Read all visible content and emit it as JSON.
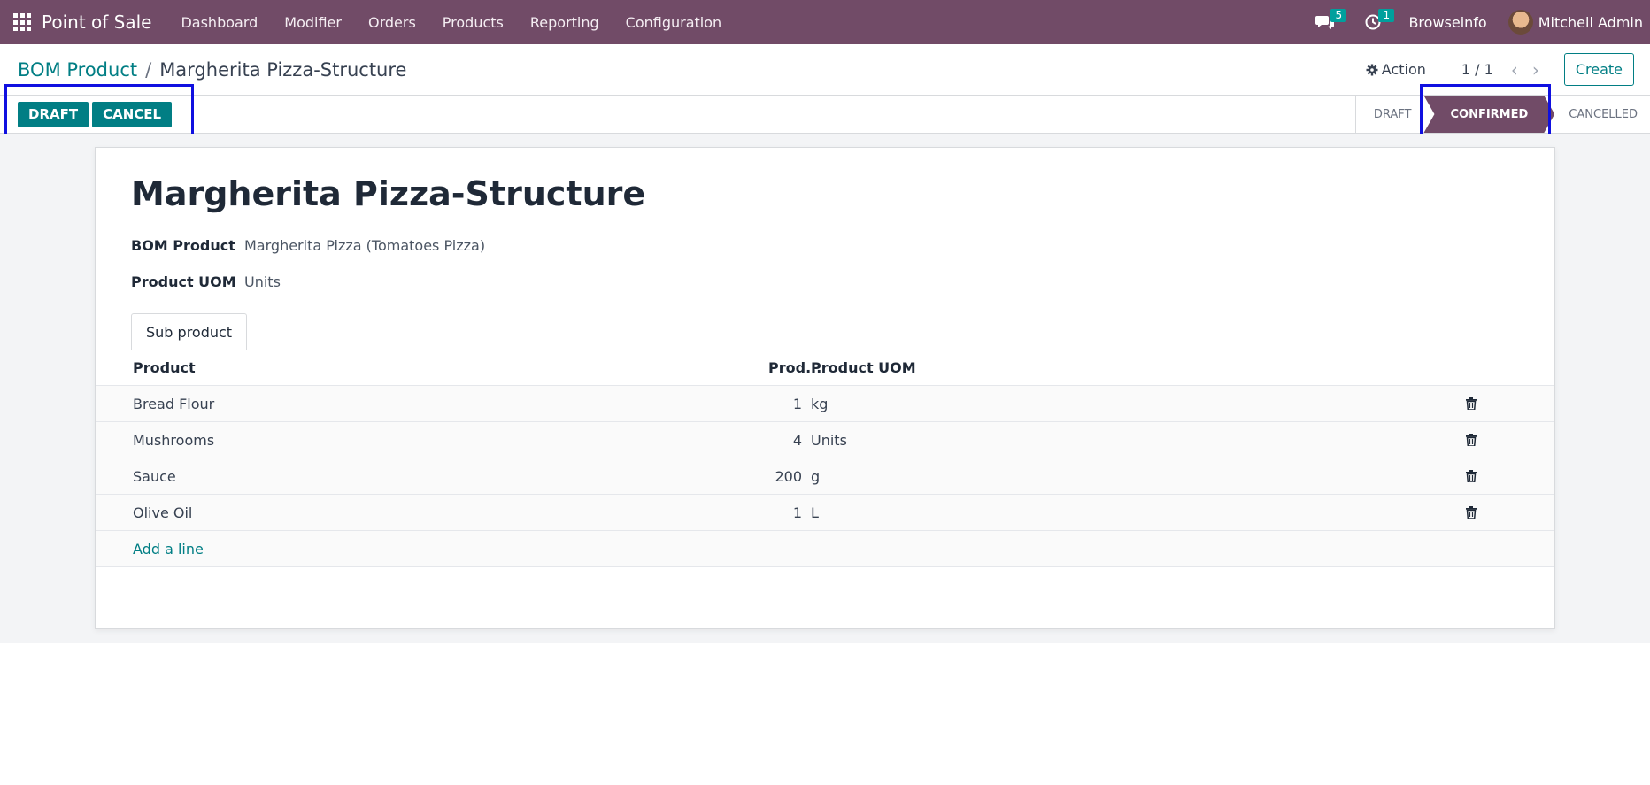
{
  "navbar": {
    "brand": "Point of Sale",
    "menu": [
      "Dashboard",
      "Modifier",
      "Orders",
      "Products",
      "Reporting",
      "Configuration"
    ],
    "messages_count": "5",
    "activities_count": "1",
    "company": "Browseinfo",
    "user": "Mitchell Admin"
  },
  "breadcrumb": {
    "parent": "BOM Product",
    "separator": "/",
    "current": "Margherita Pizza-Structure"
  },
  "control": {
    "action_label": "Action",
    "pager": "1 / 1",
    "create_label": "Create"
  },
  "statusbar": {
    "buttons": [
      "DRAFT",
      "CANCEL"
    ],
    "stages": [
      "DRAFT",
      "CONFIRMED",
      "CANCELLED"
    ],
    "active_stage": "CONFIRMED"
  },
  "record": {
    "title": "Margherita Pizza-Structure",
    "fields": [
      {
        "label": "BOM Product",
        "value": "Margherita Pizza (Tomatoes Pizza)"
      },
      {
        "label": "Product UOM",
        "value": "Units"
      }
    ]
  },
  "tabs": [
    "Sub product"
  ],
  "table": {
    "headers": {
      "product": "Product",
      "qty": "Prod...",
      "uom": "Product UOM"
    },
    "rows": [
      {
        "product": "Bread Flour",
        "qty": "1",
        "uom": "kg"
      },
      {
        "product": "Mushrooms",
        "qty": "4",
        "uom": "Units"
      },
      {
        "product": "Sauce",
        "qty": "200",
        "uom": "g"
      },
      {
        "product": "Olive Oil",
        "qty": "1",
        "uom": "L"
      }
    ],
    "add_line": "Add a line"
  },
  "colors": {
    "brand": "#714b67",
    "accent": "#017e84",
    "highlight": "#1010e0",
    "badge": "#00a09d"
  }
}
